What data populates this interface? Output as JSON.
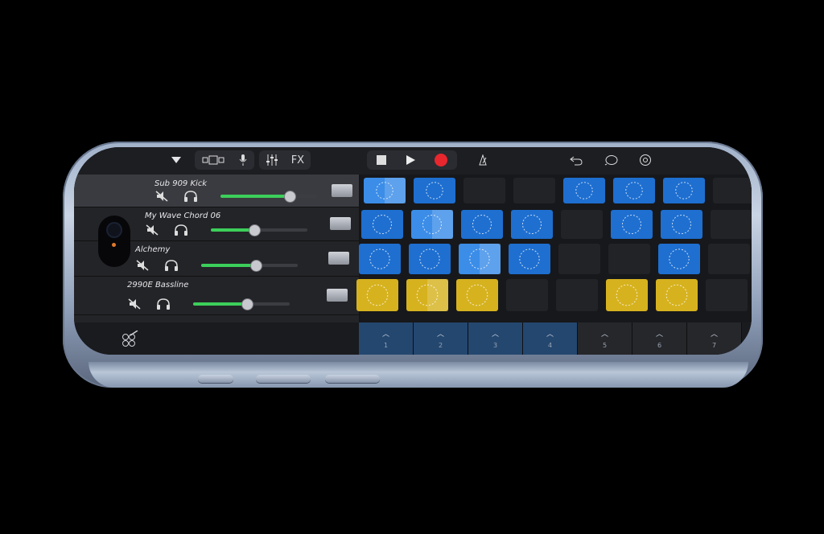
{
  "toolbar": {
    "browser_icon": "triangle-down-icon",
    "views_icon": "view-toggle-icon",
    "mic_icon": "microphone-icon",
    "mixer_icon": "mixer-sliders-icon",
    "fx_label": "FX",
    "stop_icon": "stop-icon",
    "play_icon": "play-icon",
    "record_icon": "record-icon",
    "metronome_icon": "metronome-icon",
    "undo_icon": "undo-icon",
    "loop_icon": "loop-icon",
    "settings_icon": "settings-icon",
    "record_color": "#e8262e"
  },
  "tracks": [
    {
      "name": "Sub 909 Kick",
      "volume": 0.72,
      "selected": true
    },
    {
      "name": "My Wave Chord 06",
      "volume": 0.45,
      "selected": false
    },
    {
      "name": "Alchemy",
      "volume": 0.57,
      "selected": false
    },
    {
      "name": "2990E Bassline",
      "volume": 0.56,
      "selected": false
    }
  ],
  "grid": {
    "rows": [
      [
        "blue-on",
        "blue",
        "empty",
        "empty",
        "blue",
        "blue",
        "blue",
        "empty"
      ],
      [
        "blue",
        "blue-on",
        "blue",
        "blue",
        "empty",
        "blue",
        "blue",
        "empty"
      ],
      [
        "blue",
        "blue",
        "blue-on",
        "blue",
        "empty",
        "empty",
        "blue",
        "empty"
      ],
      [
        "yellow",
        "yellow-on",
        "yellow",
        "empty",
        "empty",
        "yellow",
        "yellow",
        "empty"
      ]
    ],
    "blue_color": "#1e6fd0",
    "yellow_color": "#d6b21f"
  },
  "bottombar": {
    "left_icon": "cell-edit-icon",
    "triggers": [
      "1",
      "2",
      "3",
      "4",
      "5",
      "6",
      "7"
    ],
    "active_triggers": 4
  }
}
